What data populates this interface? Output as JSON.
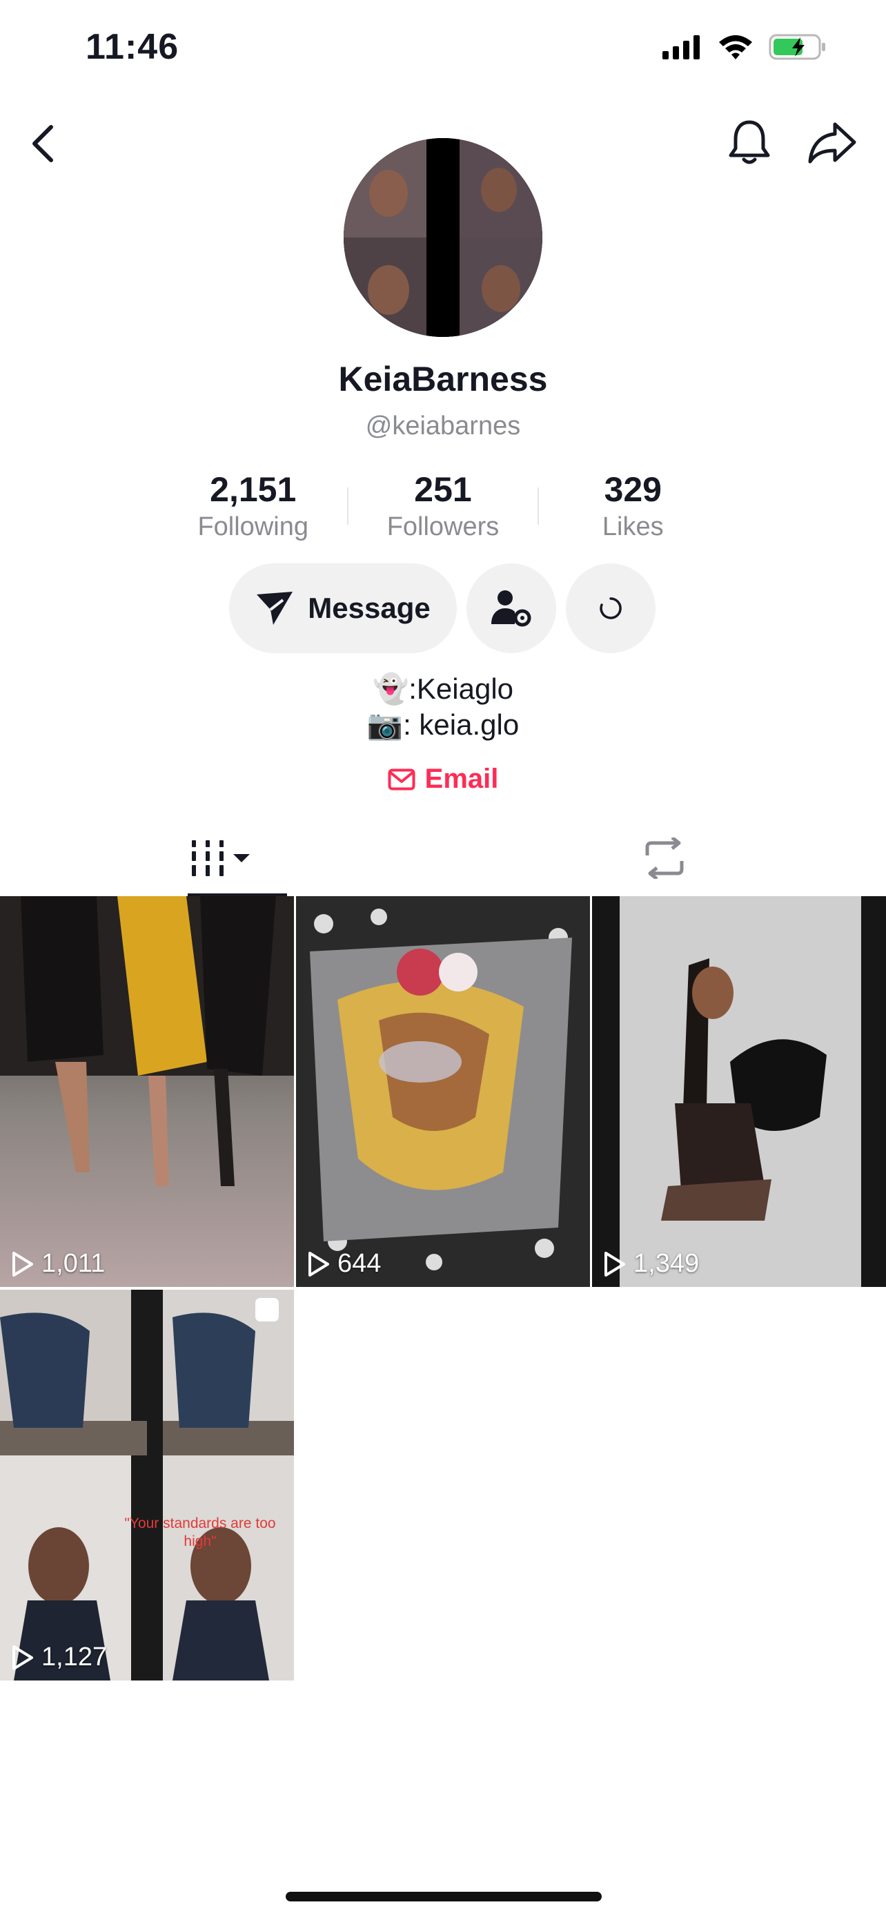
{
  "status": {
    "time": "11:46"
  },
  "profile": {
    "display_name": "KeiaBarness",
    "username": "@keiabarnes",
    "stats": {
      "following": {
        "value": "2,151",
        "label": "Following"
      },
      "followers": {
        "value": "251",
        "label": "Followers"
      },
      "likes": {
        "value": "329",
        "label": "Likes"
      }
    },
    "bio": [
      "👻:Keiaglo",
      "📷: keia.glo"
    ],
    "email_label": "Email"
  },
  "actions": {
    "message_label": "Message"
  },
  "videos": [
    {
      "views": "1,011"
    },
    {
      "views": "644"
    },
    {
      "views": "1,349"
    },
    {
      "views": "1,127",
      "caption": "\"Your standards are too high\""
    }
  ],
  "colors": {
    "accent": "#fe2c55",
    "text": "#161823",
    "muted": "#8a8b91"
  }
}
